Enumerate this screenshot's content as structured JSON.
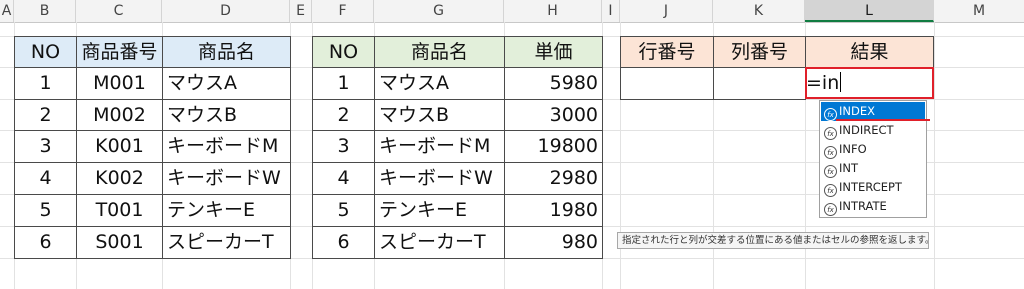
{
  "columns": [
    "A",
    "B",
    "C",
    "D",
    "E",
    "F",
    "G",
    "H",
    "I",
    "J",
    "K",
    "L",
    "M"
  ],
  "table1": {
    "headers": [
      "NO",
      "商品番号",
      "商品名"
    ],
    "rows": [
      [
        "1",
        "M001",
        "マウスA"
      ],
      [
        "2",
        "M002",
        "マウスB"
      ],
      [
        "3",
        "K001",
        "キーボードM"
      ],
      [
        "4",
        "K002",
        "キーボードW"
      ],
      [
        "5",
        "T001",
        "テンキーE"
      ],
      [
        "6",
        "S001",
        "スピーカーT"
      ]
    ]
  },
  "table2": {
    "headers": [
      "NO",
      "商品名",
      "単価"
    ],
    "rows": [
      [
        "1",
        "マウスA",
        "5980"
      ],
      [
        "2",
        "マウスB",
        "3000"
      ],
      [
        "3",
        "キーボードM",
        "19800"
      ],
      [
        "4",
        "キーボードW",
        "2980"
      ],
      [
        "5",
        "テンキーE",
        "1980"
      ],
      [
        "6",
        "スピーカーT",
        "980"
      ]
    ]
  },
  "table3": {
    "headers": [
      "行番号",
      "列番号",
      "結果"
    ]
  },
  "formula_input": "=in",
  "autocomplete": {
    "icon": "function-icon",
    "icon_glyph": "fx",
    "items": [
      "INDEX",
      "INDIRECT",
      "INFO",
      "INT",
      "INTERCEPT",
      "INTRATE"
    ],
    "selected": "INDEX"
  },
  "tooltip": "指定された行と列が交差する位置にある値またはセルの参照を返します。",
  "colors": {
    "header_blue": "#ddebf7",
    "header_green": "#e2efda",
    "header_orange": "#fce4d6",
    "active_border": "#e0202a",
    "highlight": "#0078d4"
  }
}
